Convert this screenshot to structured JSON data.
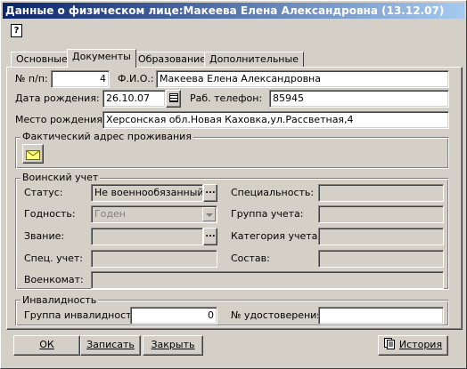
{
  "window": {
    "title": "Данные о физическом лице:Макеева Елена Александровна (13.12.07)"
  },
  "toolbar": {
    "help_icon_glyph": "?"
  },
  "tabs": [
    {
      "label": "Основные"
    },
    {
      "label": "Документы"
    },
    {
      "label": "Образование"
    },
    {
      "label": "Дополнительные"
    }
  ],
  "form": {
    "num_label": "№ п/п:",
    "num_value": "4",
    "fio_label": "Ф.И.О.:",
    "fio_value": "Макеева Елена Александровна",
    "birthdate_label": "Дата рождения:",
    "birthdate_value": "26.10.07",
    "work_phone_label": "Раб. телефон:",
    "work_phone_value": "85945",
    "birthplace_label": "Место рождения:",
    "birthplace_value": "Херсонская обл.Новая Каховка,ул.Рассветная,4"
  },
  "address_group": {
    "title": "Фактический адрес проживания"
  },
  "military": {
    "title": "Воинский учет",
    "status_label": "Статус:",
    "status_value": "Не военнообязанный",
    "fitness_label": "Годность:",
    "fitness_value": "Годен",
    "rank_label": "Звание:",
    "rank_value": "",
    "special_label": "Спец. учет:",
    "special_value": "",
    "commissariat_label": "Военкомат:",
    "commissariat_value": "",
    "specialty_label": "Специальность:",
    "specialty_value": "",
    "account_group_label": "Группа учета:",
    "account_group_value": "",
    "account_category_label": "Категория учета:",
    "account_category_value": "",
    "composition_label": "Состав:",
    "composition_value": ""
  },
  "disability": {
    "title": "Инвалидность",
    "group_label": "Группа инвалидности:",
    "group_value": "0",
    "certificate_label": "№ удостоверения:",
    "certificate_value": ""
  },
  "buttons": {
    "ok": "ОК",
    "save": "Записать",
    "close": "Закрыть",
    "history": "История"
  },
  "colors": {
    "title_start": "#0a246a",
    "title_end": "#a6caf0",
    "face": "#d4d0c8"
  }
}
